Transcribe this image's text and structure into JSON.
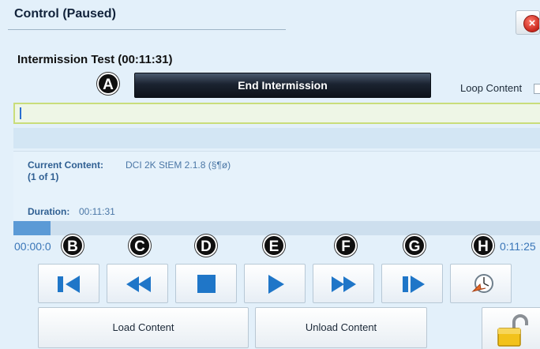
{
  "window": {
    "title": "Control (Paused)",
    "close_icon": "close-icon"
  },
  "header": {
    "subtitle": "Intermission Test (00:11:31)"
  },
  "actions": {
    "end_intermission": "End Intermission",
    "loop_content_label": "Loop Content",
    "loop_content_checked": false
  },
  "callouts": [
    "A",
    "B",
    "C",
    "D",
    "E",
    "F",
    "G",
    "H"
  ],
  "content_info": {
    "current_label": "Current Content:",
    "current_value": "DCI 2K StEM 2.1.8 (§¶ø)",
    "position": "(1 of 1)",
    "duration_label": "Duration:",
    "duration_value": "00:11:31"
  },
  "playback": {
    "elapsed": "00:00:0",
    "remaining": "0:11:25",
    "progress": 0.07
  },
  "controls": [
    {
      "name": "skip-back-button",
      "icon": "skip-back-icon"
    },
    {
      "name": "rewind-button",
      "icon": "rewind-icon"
    },
    {
      "name": "stop-button",
      "icon": "stop-icon"
    },
    {
      "name": "play-button",
      "icon": "play-icon"
    },
    {
      "name": "fast-forward-button",
      "icon": "fast-forward-icon"
    },
    {
      "name": "skip-forward-button",
      "icon": "skip-forward-icon"
    },
    {
      "name": "jump-to-time-button",
      "icon": "clock-arrow-icon"
    }
  ],
  "bottom": {
    "load_content": "Load Content",
    "unload_content": "Unload Content",
    "lock_icon": "unlocked-padlock-icon"
  },
  "colors": {
    "accent_blue": "#1f76c8",
    "badge_black": "#0f0f0f",
    "panel_bg": "#e3f0fa"
  }
}
